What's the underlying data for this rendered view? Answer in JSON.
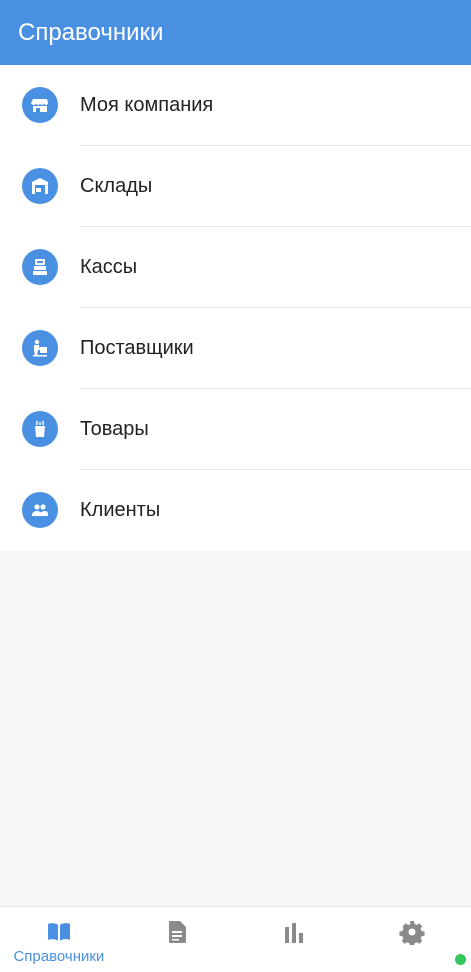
{
  "header": {
    "title": "Справочники"
  },
  "colors": {
    "accent": "#4a90e2",
    "inactive_icon": "#8a8a8a",
    "status_dot": "#34c759"
  },
  "list": {
    "items": [
      {
        "label": "Моя компания",
        "icon": "store-icon"
      },
      {
        "label": "Склады",
        "icon": "warehouse-icon"
      },
      {
        "label": "Кассы",
        "icon": "cash-register-icon"
      },
      {
        "label": "Поставщики",
        "icon": "supplier-icon"
      },
      {
        "label": "Товары",
        "icon": "goods-icon"
      },
      {
        "label": "Клиенты",
        "icon": "clients-icon"
      }
    ]
  },
  "bottom_nav": {
    "items": [
      {
        "label": "Справочники",
        "icon": "book-icon",
        "active": true
      },
      {
        "label": "",
        "icon": "document-icon",
        "active": false
      },
      {
        "label": "",
        "icon": "bar-chart-icon",
        "active": false
      },
      {
        "label": "",
        "icon": "gear-icon",
        "active": false
      }
    ]
  }
}
